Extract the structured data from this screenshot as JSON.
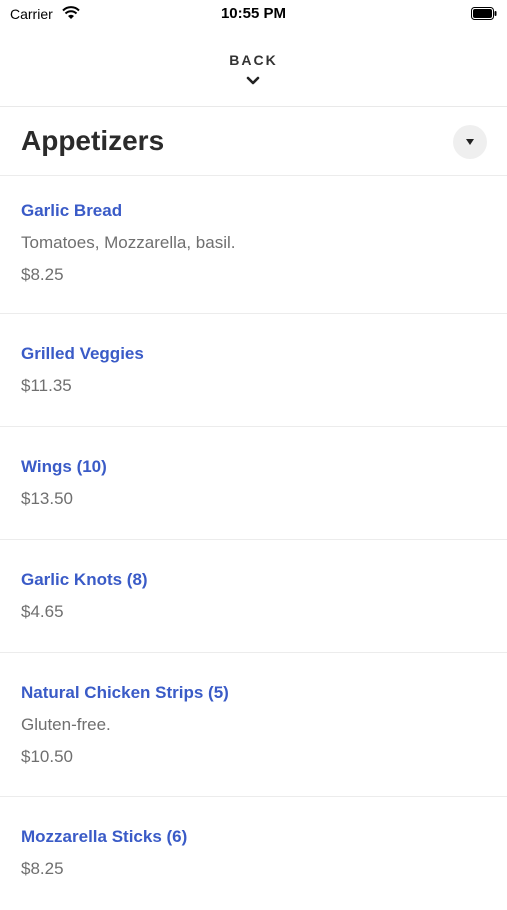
{
  "status_bar": {
    "carrier": "Carrier",
    "time": "10:55 PM"
  },
  "nav": {
    "back_label": "BACK"
  },
  "section": {
    "title": "Appetizers"
  },
  "colors": {
    "item_name": "#3a5bc7",
    "text_secondary": "#6f6f6f",
    "title": "#2b2b2b"
  },
  "items": [
    {
      "name": "Garlic Bread",
      "description": "Tomatoes, Mozzarella, basil.",
      "price": "$8.25"
    },
    {
      "name": "Grilled Veggies",
      "description": "",
      "price": "$11.35"
    },
    {
      "name": "Wings (10)",
      "description": "",
      "price": "$13.50"
    },
    {
      "name": "Garlic Knots (8)",
      "description": "",
      "price": "$4.65"
    },
    {
      "name": "Natural Chicken Strips (5)",
      "description": "Gluten-free.",
      "price": "$10.50"
    },
    {
      "name": "Mozzarella Sticks (6)",
      "description": "",
      "price": "$8.25"
    }
  ]
}
